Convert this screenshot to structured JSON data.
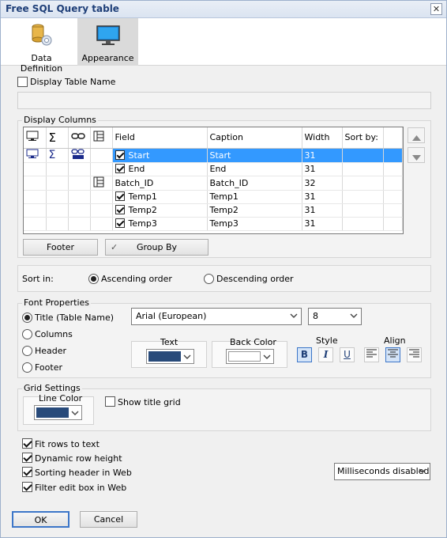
{
  "window": {
    "title": "Free SQL Query table",
    "close_label": "✕"
  },
  "tabs": [
    {
      "label": "Data Definition",
      "icon": "database-gear-icon"
    },
    {
      "label": "Appearance",
      "icon": "monitor-icon",
      "active": true
    }
  ],
  "table_name": {
    "checkbox_label": "Display Table Name",
    "checked": false,
    "value": ""
  },
  "display_columns": {
    "legend": "Display Columns",
    "headers": [
      "Field",
      "Caption",
      "Width",
      "Sort by:"
    ],
    "rows": [
      {
        "field": "Start",
        "caption": "Start",
        "width": "31",
        "checked": true,
        "selected": true
      },
      {
        "field": "End",
        "caption": "End",
        "width": "31",
        "checked": true
      },
      {
        "field": "Batch_ID",
        "caption": "Batch_ID",
        "width": "32",
        "checked": false,
        "key_icon": true
      },
      {
        "field": "Temp1",
        "caption": "Temp1",
        "width": "31",
        "checked": true
      },
      {
        "field": "Temp2",
        "caption": "Temp2",
        "width": "31",
        "checked": true
      },
      {
        "field": "Temp3",
        "caption": "Temp3",
        "width": "31",
        "checked": true
      }
    ],
    "footer_label": "Footer",
    "groupby_label": "Group By",
    "groupby_check": "✓"
  },
  "sort": {
    "label": "Sort in:",
    "ascending_label": "Ascending order",
    "descending_label": "Descending order",
    "selected": "ascending"
  },
  "font_properties": {
    "legend": "Font Properties",
    "targets": [
      "Title (Table Name)",
      "Columns",
      "Header",
      "Footer"
    ],
    "selected_target": "Title (Table Name)",
    "font_name": "Arial (European)",
    "font_size": "8",
    "text_label": "Text",
    "back_color_label": "Back Color",
    "style_label": "Style",
    "align_label": "Align",
    "text_color": "#284a7a",
    "back_color": "#ffffff",
    "bold_glyph": "B",
    "italic_glyph": "I",
    "underline_glyph": "U"
  },
  "grid_settings": {
    "legend": "Grid Settings",
    "line_color_label": "Line Color",
    "line_color": "#284a7a",
    "show_title_grid_label": "Show title grid",
    "show_title_grid": false
  },
  "options": [
    {
      "label": "Fit rows to text",
      "checked": true
    },
    {
      "label": "Dynamic row height",
      "checked": true
    },
    {
      "label": "Sorting header in Web",
      "checked": true
    },
    {
      "label": "Filter edit box in Web",
      "checked": true
    }
  ],
  "milliseconds": {
    "value": "Milliseconds disabled"
  },
  "footer_buttons": {
    "ok": "OK",
    "cancel": "Cancel"
  },
  "colors": {
    "selection": "#3399ff",
    "title_text": "#1f3f78",
    "accent": "#3c76c8"
  }
}
